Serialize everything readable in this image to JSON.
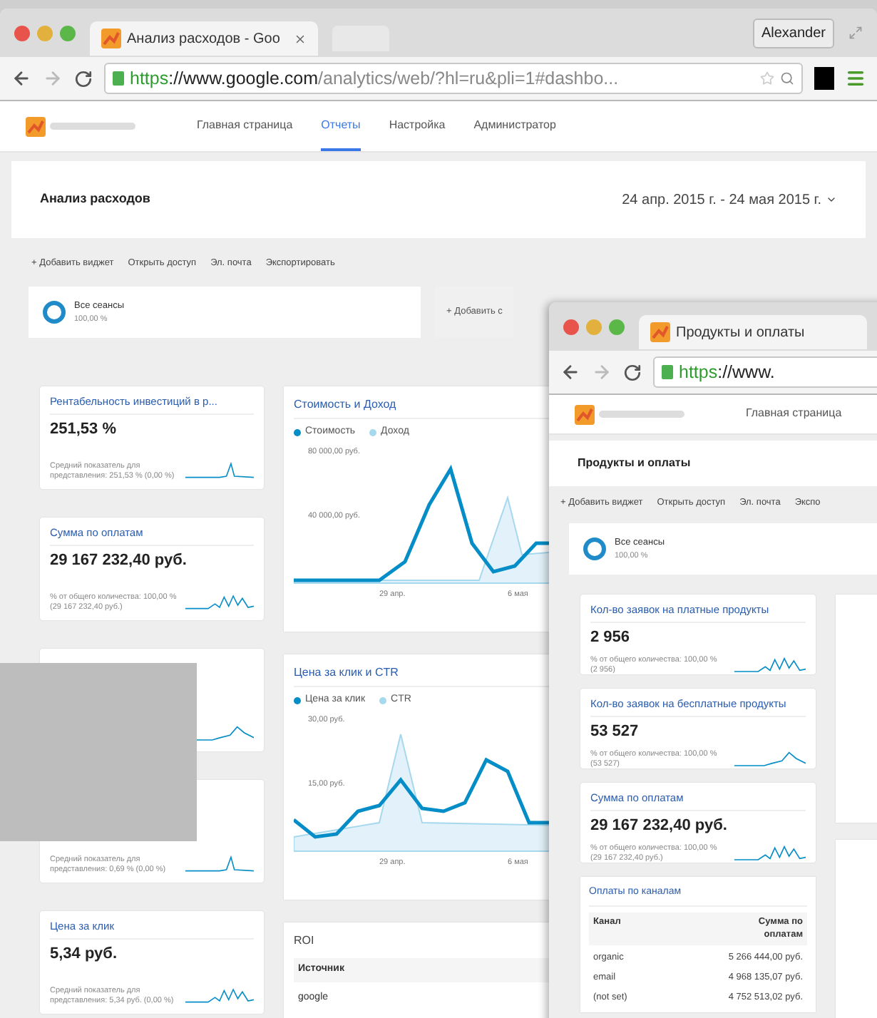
{
  "window1": {
    "tab": "Анализ расходов - Goo",
    "user": "Alexander",
    "url": {
      "scheme": "https",
      "host": "://www.google.com",
      "path": "/analytics/web/?hl=ru&pli=1#dashbo..."
    },
    "nav": [
      {
        "label": "Главная страница",
        "selected": false
      },
      {
        "label": "Отчеты",
        "selected": true
      },
      {
        "label": "Настройка",
        "selected": false
      },
      {
        "label": "Администратор",
        "selected": false
      }
    ],
    "dashboard_title": "Анализ расходов",
    "date_range": "24 апр. 2015 г. - 24 мая 2015 г.",
    "toolbar": [
      "+ Добавить виджет",
      "Открыть доступ",
      "Эл. почта",
      "Экспортировать"
    ],
    "segment": {
      "name": "Все сеансы",
      "share": "100,00 %"
    },
    "add_segment": "+ Добавить с",
    "metric_cards": [
      {
        "kind": "spike",
        "title": "Рентабельность инвестиций в р...",
        "value": "251,53 %",
        "note": "Средний показатель для представления: 251,53 % (0,00 %)"
      },
      {
        "kind": "wave",
        "title": "Сумма по оплатам",
        "value": "29 167 232,40 руб.",
        "note": "% от общего количества: 100,00 % (29 167 232,40 руб.)"
      },
      {
        "kind": "bump"
      },
      {
        "kind": "spike",
        "note": "Средний показатель для представления: 0,69 % (0,00 %)"
      },
      {
        "kind": "wave",
        "title": "Цена за клик",
        "value": "5,34 руб.",
        "note": "Средний показатель для представления: 5,34 руб. (0,00 %)"
      }
    ],
    "charts": [
      {
        "kind": "cost",
        "title": "Стоимость и Доход",
        "legend": [
          {
            "label": "Стоимость",
            "color": "#058dc7"
          },
          {
            "label": "Доход",
            "color": "#a6d8ee"
          }
        ],
        "y_labels": [
          "80 000,00 руб.",
          "40 000,00 руб."
        ],
        "x_labels": [
          "29 апр.",
          "6 мая"
        ]
      },
      {
        "kind": "cpc",
        "title": "Цена за клик и CTR",
        "legend": [
          {
            "label": "Цена за клик",
            "color": "#058dc7"
          },
          {
            "label": "CTR",
            "color": "#a6d8ee"
          }
        ],
        "y_labels": [
          "30,00 руб.",
          "15,00 руб."
        ],
        "x_labels": [
          "29 апр.",
          "6 мая"
        ]
      }
    ],
    "roi": {
      "title": "ROI",
      "column": "Источник",
      "rows": [
        "google"
      ]
    }
  },
  "window2": {
    "tab": "Продукты и оплаты",
    "url": {
      "scheme": "https",
      "host": "://www."
    },
    "nav": [
      {
        "label": "Главная страница",
        "selected": false
      }
    ],
    "dashboard_title": "Продукты и оплаты",
    "toolbar": [
      "+ Добавить виджет",
      "Открыть доступ",
      "Эл. почта",
      "Экспо"
    ],
    "segment": {
      "name": "Все сеансы",
      "share": "100,00 %"
    },
    "metric_cards": [
      {
        "kind": "wave",
        "title": "Кол-во заявок на платные продукты",
        "value": "2 956",
        "note": "% от общего количества: 100,00 % (2 956)"
      },
      {
        "kind": "bump",
        "title": "Кол-во заявок на бесплатные продукты",
        "value": "53 527",
        "note": "% от общего количества: 100,00 % (53 527)"
      },
      {
        "kind": "wave",
        "title": "Сумма по оплатам",
        "value": "29 167 232,40 руб.",
        "note": "% от общего количества: 100,00 % (29 167 232,40 руб.)"
      }
    ],
    "channels": {
      "title": "Оплаты по каналам",
      "columns": [
        "Канал",
        "Сумма по оплатам"
      ],
      "rows": [
        [
          "organic",
          "5 266 444,00 руб."
        ],
        [
          "email",
          "4 968 135,07 руб."
        ],
        [
          "(not set)",
          "4 752 513,02 руб."
        ]
      ]
    }
  }
}
